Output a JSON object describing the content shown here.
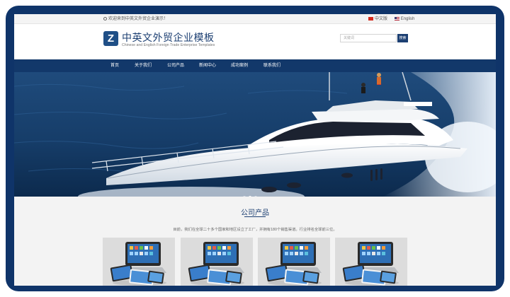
{
  "topbar": {
    "notice": "欢迎来到中英文外贸企业演示！",
    "languages": [
      {
        "label": "中文版",
        "flag": "flag-cn"
      },
      {
        "label": "English",
        "flag": "flag-us"
      }
    ]
  },
  "header": {
    "logo_letter": "Z",
    "title": "中英文外贸企业模板",
    "subtitle": "Chinese and English Foreign Trade Enterprise Templates",
    "search_placeholder": "关键词",
    "search_button": "搜索"
  },
  "nav": {
    "items": [
      {
        "label": "首页"
      },
      {
        "label": "关于我们"
      },
      {
        "label": "公司产品"
      },
      {
        "label": "新闻中心"
      },
      {
        "label": "成功案例"
      },
      {
        "label": "联系我们"
      }
    ]
  },
  "banner": {
    "slide_count": 3,
    "active_slide": 2,
    "icon": "yacht-banner-image"
  },
  "products": {
    "title": "公司产品",
    "description": "目前，我们在全球二十多个国家和地区设立了工厂，并拥有180个销售渠道。行业排名全球前三位。",
    "items": [
      {
        "icon": "tablet-product-image"
      },
      {
        "icon": "tablet-product-image"
      },
      {
        "icon": "tablet-product-image"
      },
      {
        "icon": "tablet-product-image"
      }
    ]
  },
  "colors": {
    "frame": "#0f3469",
    "nav": "#12386a",
    "accent": "#1c3f72"
  }
}
